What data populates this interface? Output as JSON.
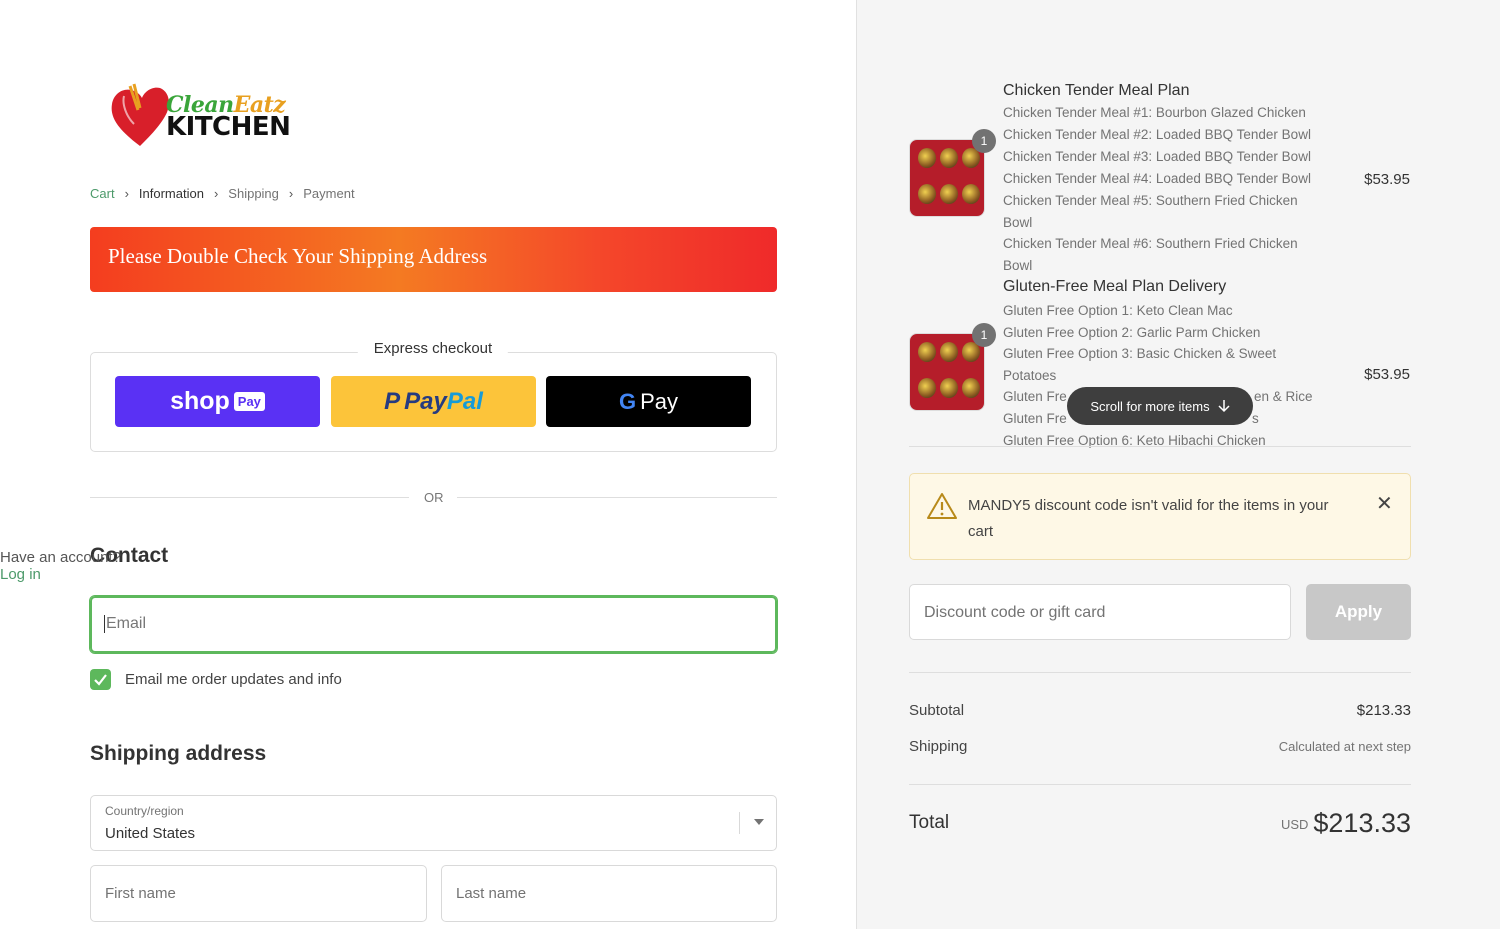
{
  "logo": {
    "line1_part1": "Clean",
    "line1_part2": "Eatz",
    "line2": "KITCHEN"
  },
  "breadcrumb": [
    {
      "label": "Cart",
      "state": "link"
    },
    {
      "label": "Information",
      "state": "current"
    },
    {
      "label": "Shipping",
      "state": "upcoming"
    },
    {
      "label": "Payment",
      "state": "upcoming"
    }
  ],
  "banner": {
    "text": "Please Double Check Your Shipping Address"
  },
  "express": {
    "title": "Express checkout",
    "shop_pay": {
      "label": "shop",
      "tag": "Pay"
    },
    "paypal": {
      "part1": "Pay",
      "part2": "Pal"
    },
    "gpay": {
      "g": "G",
      "label": "Pay"
    }
  },
  "divider": {
    "or": "OR"
  },
  "contact": {
    "heading": "Contact",
    "account_prompt": "Have an account?",
    "login": "Log in",
    "email_placeholder": "Email",
    "newsletter_label": "Email me order updates and info",
    "newsletter_checked": true
  },
  "shipping": {
    "heading": "Shipping address",
    "country_label": "Country/region",
    "country_value": "United States",
    "first_name_placeholder": "First name",
    "last_name_placeholder": "Last name"
  },
  "cart": {
    "items": [
      {
        "title": "Chicken Tender Meal Plan",
        "qty": "1",
        "price": "$53.95",
        "lines": [
          "Chicken Tender Meal #1: Bourbon Glazed Chicken",
          "Chicken Tender Meal #2: Loaded BBQ Tender Bowl",
          "Chicken Tender Meal #3: Loaded BBQ Tender Bowl",
          "Chicken Tender Meal #4: Loaded BBQ Tender Bowl",
          "Chicken Tender Meal #5: Southern Fried Chicken Bowl",
          "Chicken Tender Meal #6: Southern Fried Chicken Bowl"
        ]
      },
      {
        "title": "Gluten-Free Meal Plan Delivery",
        "qty": "1",
        "price": "$53.95",
        "lines": [
          "Gluten Free Option 1: Keto Clean Mac",
          "Gluten Free Option 2: Garlic Parm Chicken",
          "Gluten Free Option 3: Basic Chicken & Sweet Potatoes",
          "Gluten Fre",
          "en & Rice",
          "Gluten Fre",
          "s",
          "Gluten Free Option 6: Keto Hibachi Chicken"
        ]
      }
    ],
    "scroll_hint": "Scroll for more items"
  },
  "alert": {
    "message": "MANDY5 discount code isn't valid for the items in your cart"
  },
  "discount": {
    "placeholder": "Discount code or gift card",
    "apply_label": "Apply"
  },
  "summary": {
    "subtotal_label": "Subtotal",
    "subtotal_value": "$213.33",
    "shipping_label": "Shipping",
    "shipping_value": "Calculated at next step",
    "total_label": "Total",
    "currency": "USD",
    "total_value": "$213.33"
  },
  "colors": {
    "accent_green": "#5db85c",
    "link_green": "#4c9a6a",
    "shop_pay": "#5a31f4",
    "paypal": "#fcc43a",
    "banner_red": "#f43d1f"
  }
}
